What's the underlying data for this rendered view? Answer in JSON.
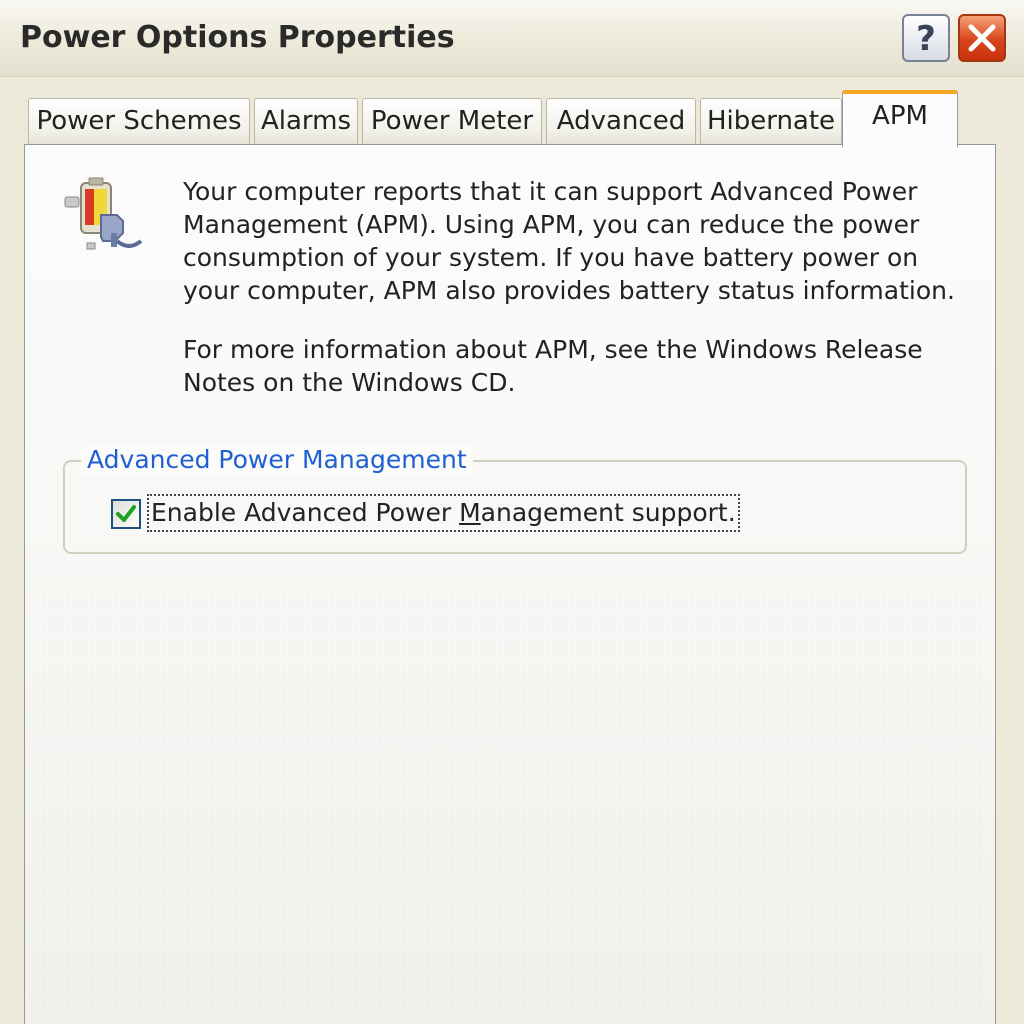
{
  "window": {
    "title": "Power Options Properties",
    "help_glyph": "?",
    "close_icon": "close-x-icon"
  },
  "tabs": [
    {
      "label": "Power Schemes",
      "active": false
    },
    {
      "label": "Alarms",
      "active": false
    },
    {
      "label": "Power Meter",
      "active": false
    },
    {
      "label": "Advanced",
      "active": false
    },
    {
      "label": "Hibernate",
      "active": false
    },
    {
      "label": "APM",
      "active": true
    }
  ],
  "apm_page": {
    "icon": "battery-plug-icon",
    "description": "Your computer reports that it can support Advanced Power Management (APM).  Using APM, you can reduce the power consumption of your system.  If you have battery power on your computer, APM also provides battery status information.",
    "more_info": "For more information about APM, see the Windows Release Notes on the Windows CD.",
    "group": {
      "label": "Advanced Power Management",
      "checkbox": {
        "checked": true,
        "label_before": "Enable Advanced Power ",
        "label_mnemonic": "M",
        "label_after": "anagement support."
      }
    }
  },
  "colors": {
    "accent_tab": "#f5a623",
    "group_label": "#1f5fd3",
    "check": "#21a121",
    "close_button": "#d8451b"
  }
}
